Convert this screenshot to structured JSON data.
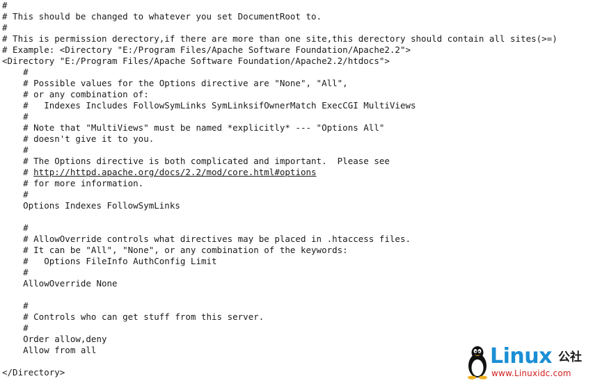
{
  "document": {
    "lines": [
      {
        "text": "#"
      },
      {
        "text": "# This should be changed to whatever you set DocumentRoot to."
      },
      {
        "text": "#"
      },
      {
        "text": "# This is permission derectory,if there are more than one site,this derectory should contain all sites(>=)"
      },
      {
        "text": "# Example: <Directory \"E:/Program Files/Apache Software Foundation/Apache2.2\">"
      },
      {
        "text": "<Directory \"E:/Program Files/Apache Software Foundation/Apache2.2/htdocs\">"
      },
      {
        "text": "    #"
      },
      {
        "text": "    # Possible values for the Options directive are \"None\", \"All\","
      },
      {
        "text": "    # or any combination of:"
      },
      {
        "text": "    #   Indexes Includes FollowSymLinks SymLinksifOwnerMatch ExecCGI MultiViews"
      },
      {
        "text": "    #"
      },
      {
        "text": "    # Note that \"MultiViews\" must be named *explicitly* --- \"Options All\""
      },
      {
        "text": "    # doesn't give it to you."
      },
      {
        "text": "    #"
      },
      {
        "text": "    # The Options directive is both complicated and important.  Please see"
      },
      {
        "text": "    # ",
        "link": "http://httpd.apache.org/docs/2.2/mod/core.html#options"
      },
      {
        "text": "    # for more information."
      },
      {
        "text": "    #"
      },
      {
        "text": "    Options Indexes FollowSymLinks"
      },
      {
        "text": ""
      },
      {
        "text": "    #"
      },
      {
        "text": "    # AllowOverride controls what directives may be placed in .htaccess files."
      },
      {
        "text": "    # It can be \"All\", \"None\", or any combination of the keywords:"
      },
      {
        "text": "    #   Options FileInfo AuthConfig Limit"
      },
      {
        "text": "    #"
      },
      {
        "text": "    AllowOverride None"
      },
      {
        "text": ""
      },
      {
        "text": "    #"
      },
      {
        "text": "    # Controls who can get stuff from this server."
      },
      {
        "text": "    #"
      },
      {
        "text": "    Order allow,deny"
      },
      {
        "text": "    Allow from all"
      },
      {
        "text": ""
      },
      {
        "text": "</Directory>"
      }
    ]
  },
  "watermark": {
    "brand": "Linux",
    "brand_cn": "公社",
    "url": "www.Linuxidc.com",
    "icon": "penguin-icon",
    "colors": {
      "brand": "#1a8fd6",
      "url": "#d02020"
    }
  }
}
